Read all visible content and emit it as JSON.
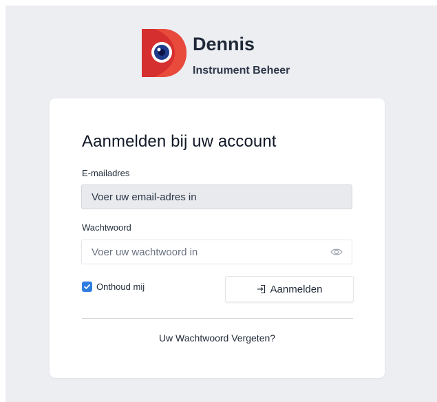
{
  "brand": {
    "name": "Dennis",
    "subtitle": "Instrument Beheer",
    "logo_colors": {
      "primary": "#e53935",
      "dark": "#b71c1c",
      "eye": "#1e3a8a"
    }
  },
  "login": {
    "title": "Aanmelden bij uw account",
    "email_label": "E-mailadres",
    "email_placeholder": "Voer uw email-adres in",
    "password_label": "Wachtwoord",
    "password_placeholder": "Voer uw wachtwoord in",
    "remember_label": "Onthoud mij",
    "remember_checked": true,
    "submit_label": "Aanmelden",
    "forgot_label": "Uw Wachtwoord Vergeten?"
  },
  "icons": {
    "password_toggle": "eye-icon",
    "submit": "login-icon",
    "checkbox": "checkmark-icon"
  },
  "colors": {
    "background": "#eceef2",
    "card": "#ffffff",
    "accent": "#2f7de1"
  }
}
